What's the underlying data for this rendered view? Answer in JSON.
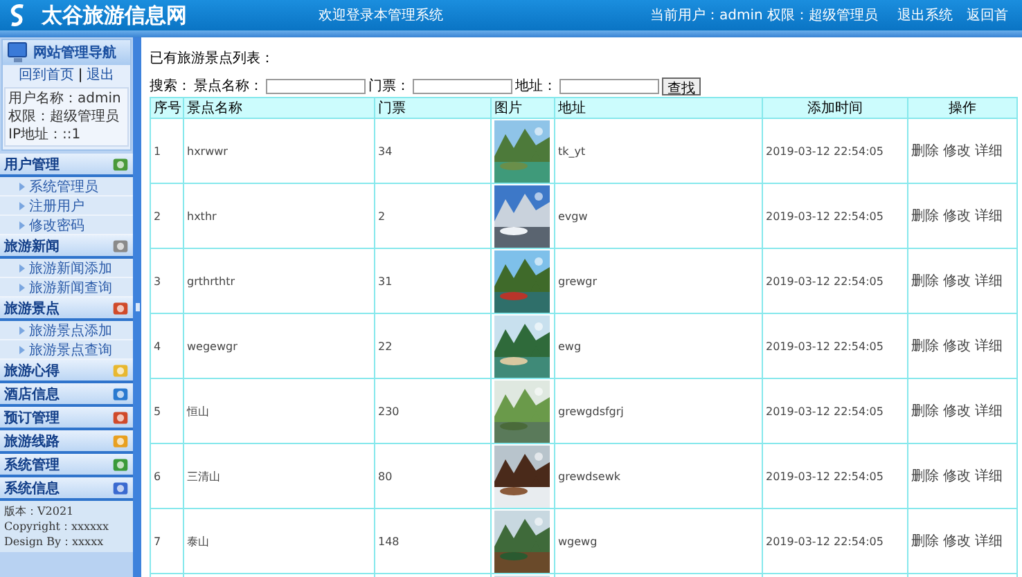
{
  "header": {
    "site_title": "太谷旅游信息网",
    "welcome": "欢迎登录本管理系统",
    "current_user": "当前用户：admin 权限：超级管理员",
    "links": [
      "退出系统",
      "返回首"
    ]
  },
  "sidebar": {
    "banner": "网站管理导航",
    "top_links": [
      "回到首页",
      "|",
      "退出"
    ],
    "user_info": [
      "用户名称：admin",
      "权限：超级管理员",
      "IP地址：::1"
    ],
    "sections": [
      {
        "label": "用户管理",
        "children": [
          "系统管理员",
          "注册用户",
          "修改密码"
        ]
      },
      {
        "label": "旅游新闻",
        "children": [
          "旅游新闻添加",
          "旅游新闻查询"
        ]
      },
      {
        "label": "旅游景点",
        "children": [
          "旅游景点添加",
          "旅游景点查询"
        ]
      },
      {
        "label": "旅游心得"
      },
      {
        "label": "酒店信息"
      },
      {
        "label": "预订管理"
      },
      {
        "label": "旅游线路"
      },
      {
        "label": "系统管理"
      },
      {
        "label": "系统信息"
      }
    ],
    "footer": [
      "版本：V2021",
      "Copyright：xxxxxx",
      "Design By：xxxxx"
    ]
  },
  "content": {
    "title": "已有旅游景点列表：",
    "search": {
      "label": "搜索：",
      "fields": [
        "景点名称：",
        "门票：",
        "地址："
      ],
      "button": "查找"
    },
    "table": {
      "columns": [
        "序号",
        "景点名称",
        "门票",
        "图片",
        "地址",
        "添加时间",
        "操作"
      ],
      "rows": [
        {
          "index": "1",
          "name": "hxrwwr",
          "ticket": "34",
          "picture": {
            "kind": "picture"
          },
          "address": "tk_yt",
          "time": "2019-03-12 22:54:05",
          "actions": [
            "删除",
            "修改",
            "详细"
          ]
        },
        {
          "index": "2",
          "name": "hxthr",
          "ticket": "2",
          "picture": {
            "kind": "picture"
          },
          "address": "evgw",
          "time": "2019-03-12 22:54:05",
          "actions": [
            "删除",
            "修改",
            "详细"
          ]
        },
        {
          "index": "3",
          "name": "grthrthtr",
          "ticket": "31",
          "picture": {
            "kind": "picture"
          },
          "address": "grewgr",
          "time": "2019-03-12 22:54:05",
          "actions": [
            "删除",
            "修改",
            "详细"
          ]
        },
        {
          "index": "4",
          "name": "wegewgr",
          "ticket": "22",
          "picture": {
            "kind": "picture"
          },
          "address": "ewg",
          "time": "2019-03-12 22:54:05",
          "actions": [
            "删除",
            "修改",
            "详细"
          ]
        },
        {
          "index": "5",
          "name": "恒山",
          "ticket": "230",
          "picture": {
            "kind": "picture"
          },
          "address": "grewgdsfgrj",
          "time": "2019-03-12 22:54:05",
          "actions": [
            "删除",
            "修改",
            "详细"
          ]
        },
        {
          "index": "6",
          "name": "三清山",
          "ticket": "80",
          "picture": {
            "kind": "picture"
          },
          "address": "grewdsewk",
          "time": "2019-03-12 22:54:05",
          "actions": [
            "删除",
            "修改",
            "详细"
          ]
        },
        {
          "index": "7",
          "name": "泰山",
          "ticket": "148",
          "picture": {
            "kind": "picture"
          },
          "address": "wgewg",
          "time": "2019-03-12 22:54:05",
          "actions": [
            "删除",
            "修改",
            "详细"
          ]
        },
        {
          "picture": {
            "kind": "picture"
          }
        }
      ]
    }
  }
}
